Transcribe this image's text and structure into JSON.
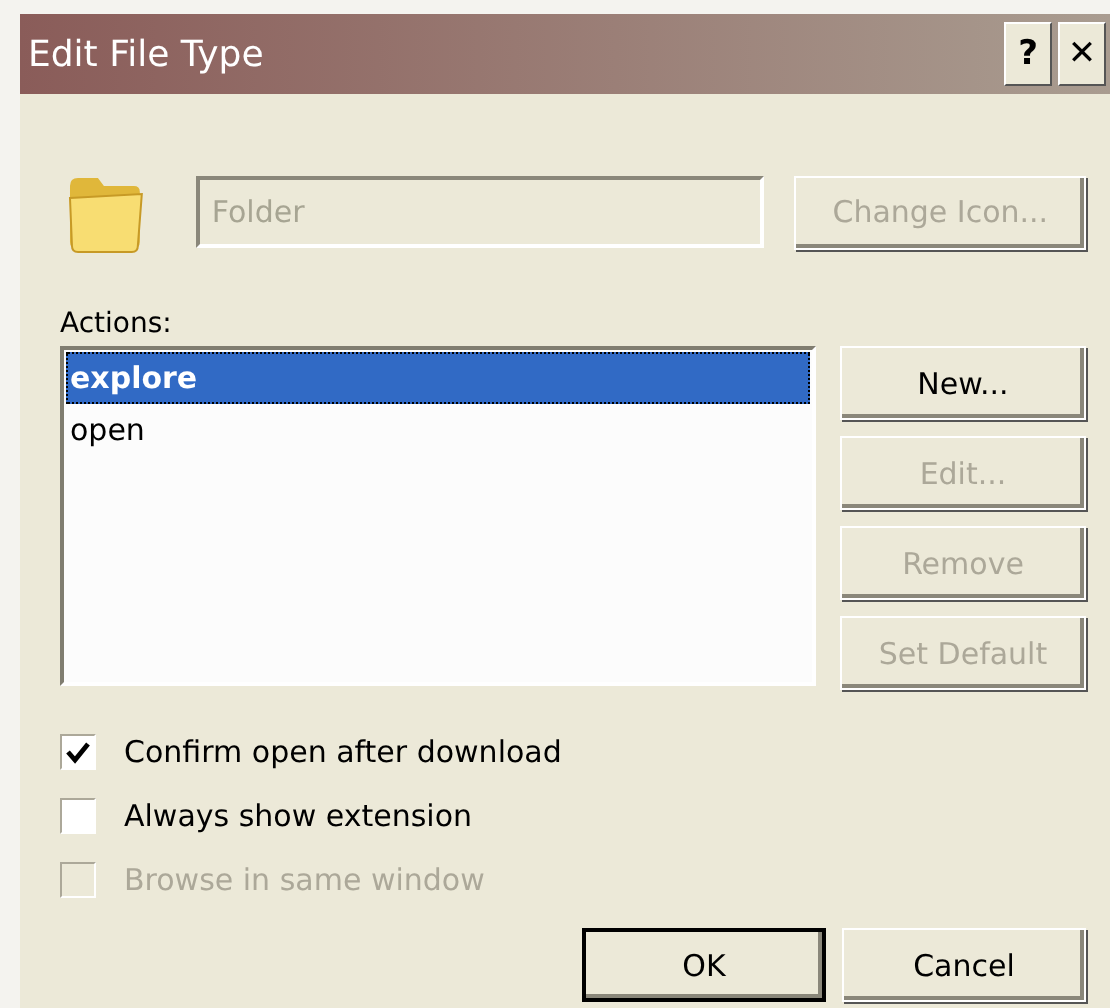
{
  "window": {
    "title": "Edit File Type",
    "help_button": "?",
    "close_button": "✕"
  },
  "file_type": {
    "value": "Folder",
    "disabled": true
  },
  "change_icon_button": {
    "label": "Change Icon...",
    "disabled": true
  },
  "actions": {
    "label": "Actions:",
    "items": [
      {
        "label": "explore",
        "selected": true,
        "default": true
      },
      {
        "label": "open",
        "selected": false,
        "default": false
      }
    ]
  },
  "action_buttons": [
    {
      "label": "New...",
      "disabled": false
    },
    {
      "label": "Edit...",
      "disabled": true
    },
    {
      "label": "Remove",
      "disabled": true
    },
    {
      "label": "Set Default",
      "disabled": true
    }
  ],
  "options": [
    {
      "label": "Confirm open after download",
      "checked": true,
      "disabled": false
    },
    {
      "label": "Always show extension",
      "checked": false,
      "disabled": false
    },
    {
      "label": "Browse in same window",
      "checked": false,
      "disabled": true
    }
  ],
  "buttons": [
    {
      "label": "OK",
      "default": true
    },
    {
      "label": "Cancel",
      "default": false
    }
  ]
}
